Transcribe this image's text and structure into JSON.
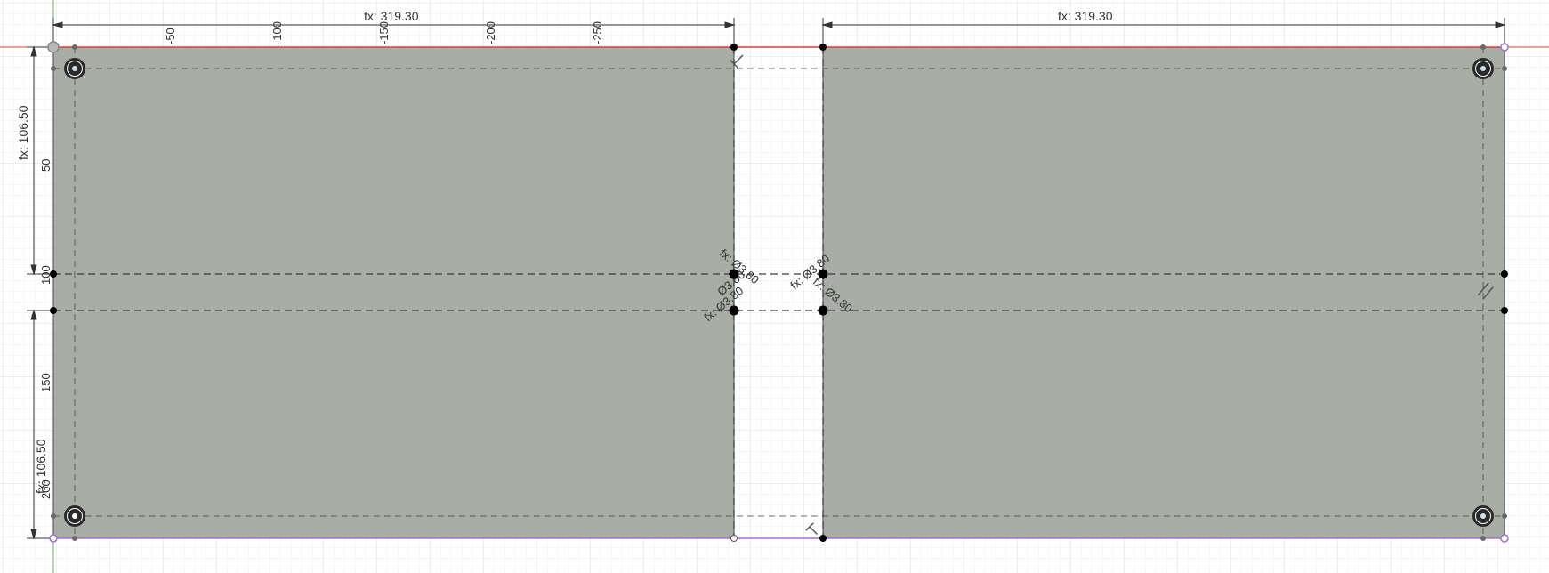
{
  "sketch": {
    "colors": {
      "background": "#ffffff",
      "grid_minor": "#eeeeee",
      "grid_major": "#dcdcdc",
      "plate_fill": "#99a097",
      "plate_fill_opacity": "0.85",
      "plate_stroke": "#4a4a4a",
      "plate_bottom_edge": "#a070d0",
      "origin_axis_red": "#d04040",
      "origin_axis_green": "#60b060",
      "point": "#000000",
      "construction_line": "#3a3a3a",
      "hole_ring": "#ffffff",
      "hole_center": "#2a2a2a"
    },
    "dimensions": {
      "left_width": "fx: 319.30",
      "right_width": "fx: 319.30",
      "top_height": "fx: 106.50",
      "bottom_height": "fx: 106.50",
      "diameter_1": "fx: Ø3.80",
      "diameter_2": "Ø3.80",
      "diameter_3": "fx: Ø3.80",
      "diameter_4": "fx: Ø3.80",
      "diameter_5": "fx: Ø3.80"
    },
    "ruler_top": [
      "-50",
      "-100",
      "-150",
      "-200",
      "-250"
    ],
    "ruler_left": [
      "50",
      "100",
      "150",
      "200"
    ],
    "icons": {
      "constraint_top": "perpendicular-constraint-icon",
      "constraint_bottom": "perpendicular-constraint-icon",
      "constraint_right": "parallel-constraint-icon"
    }
  }
}
